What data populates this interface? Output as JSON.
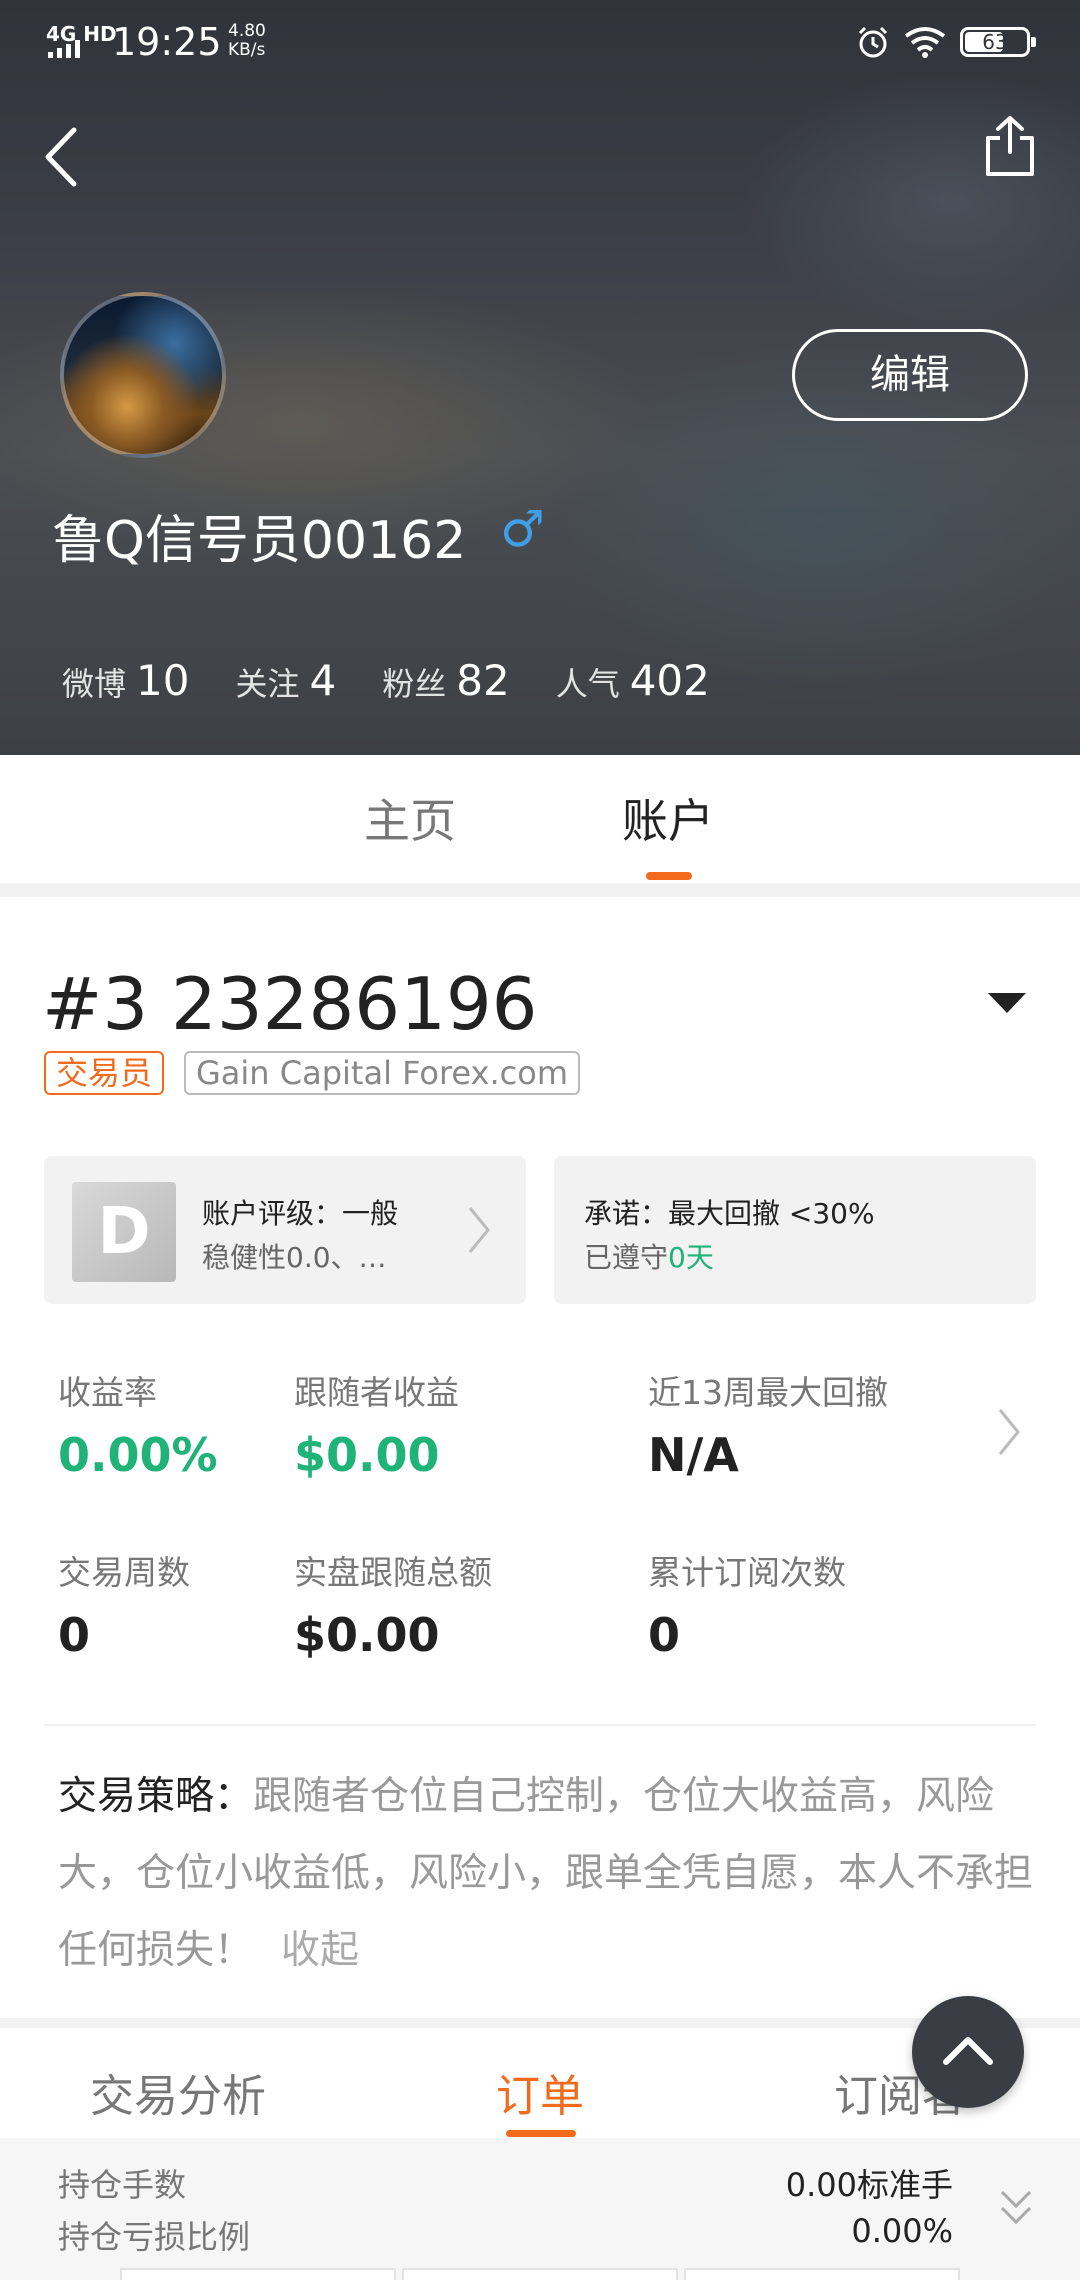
{
  "status_bar": {
    "network": "4G HD",
    "time": "19:25",
    "speed_value": "4.80",
    "speed_unit": "KB/s",
    "battery": "63"
  },
  "profile": {
    "name": "鲁Q信号员00162",
    "gender_symbol": "♂",
    "edit_label": "编辑",
    "stats": [
      {
        "label": "微博",
        "value": "10"
      },
      {
        "label": "关注",
        "value": "4"
      },
      {
        "label": "粉丝",
        "value": "82"
      },
      {
        "label": "人气",
        "value": "402"
      }
    ]
  },
  "tabs": {
    "home": "主页",
    "account": "账户",
    "active": "account"
  },
  "account": {
    "title": "#3 23286196",
    "role_tag": "交易员",
    "broker_tag": "Gain Capital Forex.com",
    "rating_card": {
      "grade": "D",
      "line1": "账户评级：一般",
      "line2": "稳健性0.0、…"
    },
    "promise_card": {
      "line1": "承诺：最大回撤 <30%",
      "line2_prefix": "已遵守",
      "line2_value": "0天"
    },
    "metrics": [
      {
        "label": "收益率",
        "value": "0.00%"
      },
      {
        "label": "跟随者收益",
        "value": "$0.00"
      },
      {
        "label": "近13周最大回撤",
        "value": "N/A"
      },
      {
        "label": "交易周数",
        "value": "0"
      },
      {
        "label": "实盘跟随总额",
        "value": "$0.00"
      },
      {
        "label": "累计订阅次数",
        "value": "0"
      }
    ],
    "strategy": {
      "label": "交易策略：",
      "text": "跟随者仓位自己控制，仓位大收益高，风险大，仓位小收益低，风险小，跟单全凭自愿，本人不承担任何损失！",
      "collapse": "收起"
    }
  },
  "subtabs": {
    "items": [
      "交易分析",
      "订单",
      "订阅者"
    ],
    "active": "订单"
  },
  "summary": {
    "rows": [
      {
        "label": "持仓手数",
        "value": "0.00标准手"
      },
      {
        "label": "持仓亏损比例",
        "value": "0.00%"
      }
    ]
  },
  "colors": {
    "accent": "#f26b1d",
    "positive": "#1fb37a",
    "gender": "#3f9fe6"
  },
  "icons": [
    "back-arrow-icon",
    "share-icon",
    "alarm-icon",
    "wifi-icon",
    "chevron-right-icon",
    "dropdown-triangle-icon",
    "scroll-top-icon",
    "expand-down-icon"
  ]
}
